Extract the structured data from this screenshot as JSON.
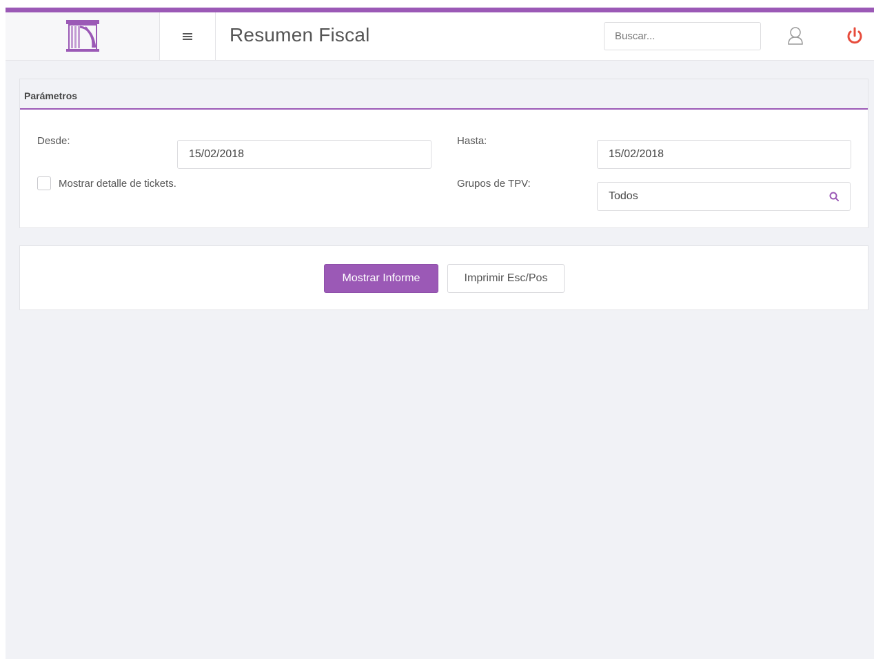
{
  "header": {
    "title": "Resumen Fiscal",
    "search_placeholder": "Buscar...",
    "menu_icon": "hamburger-icon",
    "user_icon": "user-icon",
    "power_icon": "power-icon"
  },
  "params_panel": {
    "heading": "Parámetros",
    "desde_label": "Desde:",
    "desde_value": "15/02/2018",
    "hasta_label": "Hasta:",
    "hasta_value": "15/02/2018",
    "checkbox_label": "Mostrar detalle de tickets.",
    "grupos_label": "Grupos de TPV:",
    "grupos_value": "Todos"
  },
  "actions": {
    "show_report": "Mostrar Informe",
    "print": "Imprimir Esc/Pos"
  },
  "colors": {
    "accent": "#9b59b6",
    "power": "#e74c3c",
    "background": "#f1f2f6"
  }
}
